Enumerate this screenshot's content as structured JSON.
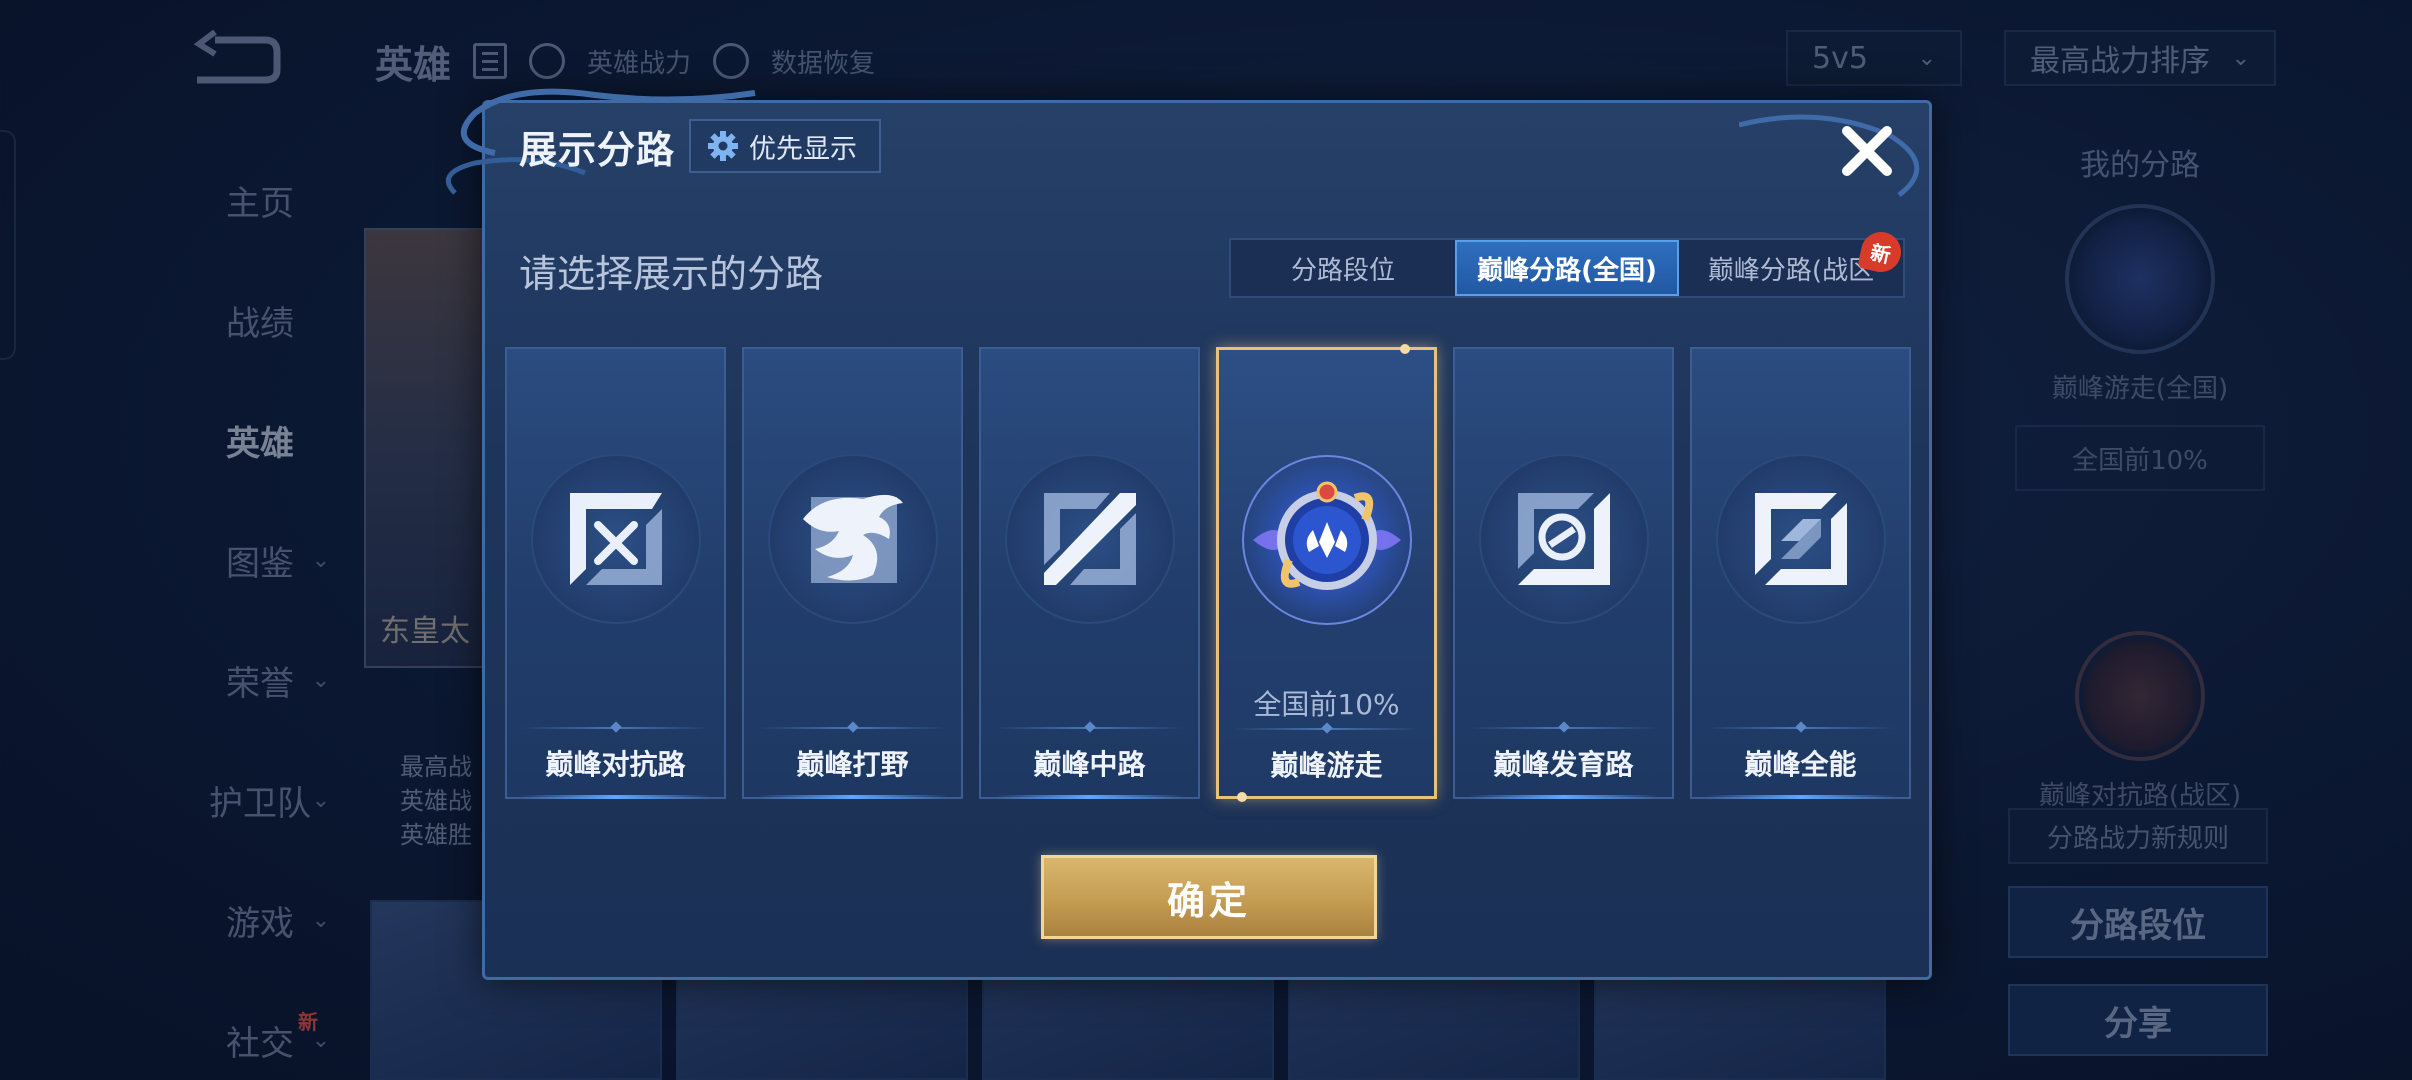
{
  "background": {
    "header_title": "英雄",
    "header_links": [
      "英雄战力",
      "数据恢复"
    ],
    "mode_select": "5v5",
    "sort_select": "最高战力排序",
    "nav_items": [
      {
        "label": "主页",
        "chevron": false
      },
      {
        "label": "战绩",
        "chevron": false
      },
      {
        "label": "英雄",
        "chevron": false,
        "active": true
      },
      {
        "label": "图鉴",
        "chevron": true
      },
      {
        "label": "荣誉",
        "chevron": true
      },
      {
        "label": "护卫队",
        "chevron": true
      },
      {
        "label": "游戏",
        "chevron": true
      },
      {
        "label": "社交",
        "chevron": true,
        "badge": "新"
      }
    ],
    "hero_name": "东皇太",
    "stats": [
      "最高战",
      "英雄战",
      "英雄胜"
    ],
    "right_panel": {
      "title": "我的分路",
      "emblem_label": "巅峰游走(全国)",
      "rank_box": "全国前10%",
      "emblem2_label": "巅峰对抗路(战区)",
      "rules_note": "分路战力新规则",
      "lane_rank_button": "分路段位",
      "share_button": "分享"
    }
  },
  "dialog": {
    "title": "展示分路",
    "priority_button": "优先显示",
    "subtitle": "请选择展示的分路",
    "tabs": [
      {
        "label": "分路段位",
        "active": false
      },
      {
        "label": "巅峰分路(全国)",
        "active": true
      },
      {
        "label": "巅峰分路(战区",
        "active": false,
        "badge": "新"
      }
    ],
    "lanes": [
      {
        "label": "巅峰对抗路",
        "icon": "clash-lane-icon",
        "selected": false,
        "percent": ""
      },
      {
        "label": "巅峰打野",
        "icon": "jungle-icon",
        "selected": false,
        "percent": ""
      },
      {
        "label": "巅峰中路",
        "icon": "mid-lane-icon",
        "selected": false,
        "percent": ""
      },
      {
        "label": "巅峰游走",
        "icon": "roam-emblem-icon",
        "selected": true,
        "percent": "全国前10%"
      },
      {
        "label": "巅峰发育路",
        "icon": "farm-lane-icon",
        "selected": false,
        "percent": ""
      },
      {
        "label": "巅峰全能",
        "icon": "all-round-icon",
        "selected": false,
        "percent": ""
      }
    ],
    "confirm_button": "确定"
  },
  "colors": {
    "selected_border": "#e6c27d",
    "active_tab": "#2a65b2",
    "confirm_gold": "#c9a25a",
    "new_badge": "#d93b2b"
  }
}
